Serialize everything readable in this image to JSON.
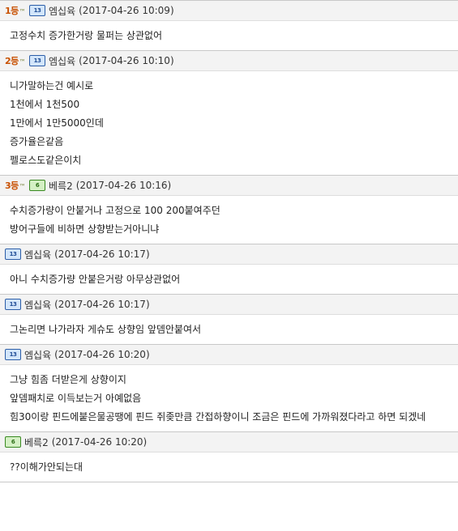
{
  "comments": [
    {
      "rank": "1",
      "rank_suffix": "등",
      "level_icon": "level-badge-blue",
      "level_text": "13",
      "author": "엠십육",
      "date": "(2017-04-26 10:09)",
      "lines": [
        "고정수치 증가한거랑 물퍼는 상관없어"
      ]
    },
    {
      "rank": "2",
      "rank_suffix": "등",
      "level_icon": "level-badge-blue",
      "level_text": "13",
      "author": "엠십육",
      "date": "(2017-04-26 10:10)",
      "lines": [
        "니가말하는건 예시로",
        "1천에서 1천500",
        "1만에서 1만5000인데",
        "증가율은같음",
        "펠로스도같은이치"
      ]
    },
    {
      "rank": "3",
      "rank_suffix": "등",
      "level_icon": "level-badge-green",
      "level_text": "6",
      "author": "베륵2",
      "date": "(2017-04-26 10:16)",
      "lines": [
        "수치증가량이 안붙거나 고정으로 100  200붙여주던",
        "방어구들에 비하면 상향받는거아니냐"
      ]
    },
    {
      "rank": "",
      "rank_suffix": "",
      "level_icon": "level-badge-blue",
      "level_text": "13",
      "author": "엠십육",
      "date": "(2017-04-26 10:17)",
      "lines": [
        "아니 수치증가량 안붙은거랑 아무상관없어"
      ]
    },
    {
      "rank": "",
      "rank_suffix": "",
      "level_icon": "level-badge-blue",
      "level_text": "13",
      "author": "엠십육",
      "date": "(2017-04-26 10:17)",
      "lines": [
        "그논리면 나가라자 게슈도 상향임 앞뎀안붙여서"
      ]
    },
    {
      "rank": "",
      "rank_suffix": "",
      "level_icon": "level-badge-blue",
      "level_text": "13",
      "author": "엠십육",
      "date": "(2017-04-26 10:20)",
      "lines": [
        "그냥 힘좀 더받은게 상향이지",
        "앞뎀패치로 이득보는거 아예없음",
        "힘30이랑 핀드에붙은물공땡에 핀드 쥐좆만큼 간접하향이니 조금은 핀드에 가까워졌다라고 하면 되겠네"
      ]
    },
    {
      "rank": "",
      "rank_suffix": "",
      "level_icon": "level-badge-green",
      "level_text": "6",
      "author": "베륵2",
      "date": "(2017-04-26 10:20)",
      "lines": [
        "??이해가안되는대"
      ]
    }
  ]
}
